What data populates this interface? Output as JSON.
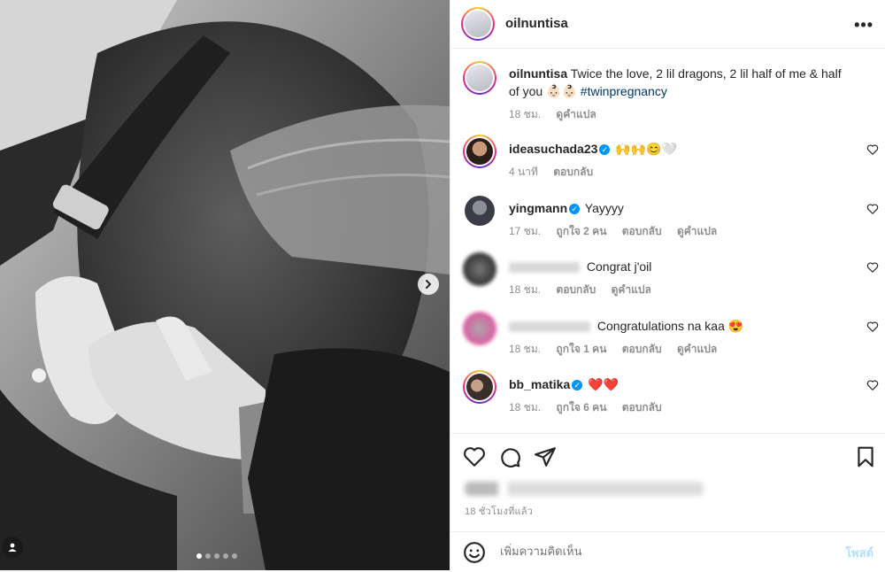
{
  "post": {
    "username": "oilnuntisa",
    "more_label": "•••",
    "caption_user": "oilnuntisa",
    "caption_text": "Twice the love, 2 lil dragons, 2 lil half of me & half of you 👶🏻👶🏻",
    "caption_hashtag": "#twinpregnancy",
    "caption_time": "18 ชม.",
    "caption_translate": "ดูคำแปล",
    "carousel_total": 5,
    "carousel_active": 1
  },
  "comments": [
    {
      "user": "ideasuchada23",
      "verified": true,
      "text": "🙌🙌😊🤍",
      "time": "4 นาที",
      "likes": "",
      "reply": "ตอบกลับ",
      "translate": ""
    },
    {
      "user": "yingmann",
      "verified": true,
      "text": "Yayyyy",
      "time": "17 ชม.",
      "likes": "ถูกใจ 2 คน",
      "reply": "ตอบกลับ",
      "translate": "ดูคำแปล"
    },
    {
      "user": "",
      "verified": false,
      "text": "Congrat j'oil",
      "time": "18 ชม.",
      "likes": "",
      "reply": "ตอบกลับ",
      "translate": "ดูคำแปล"
    },
    {
      "user": "",
      "verified": false,
      "text": "Congratulations na kaa 😍",
      "time": "18 ชม.",
      "likes": "ถูกใจ 1 คน",
      "reply": "ตอบกลับ",
      "translate": "ดูคำแปล"
    },
    {
      "user": "bb_matika",
      "verified": true,
      "text": "❤️❤️",
      "time": "18 ชม.",
      "likes": "ถูกใจ 6 คน",
      "reply": "ตอบกลับ",
      "translate": ""
    }
  ],
  "footer": {
    "time_ago": "18 ชั่วโมงที่แล้ว",
    "comment_placeholder": "เพิ่มความคิดเห็น",
    "post_label": "โพสต์"
  },
  "icons": {
    "like": "heart-icon",
    "comment": "comment-icon",
    "share": "share-icon",
    "save": "bookmark-icon",
    "emoji": "emoji-icon",
    "next": "chevron-right-icon",
    "tag": "user-tag-icon"
  },
  "colors": {
    "link": "#00376b",
    "verified": "#0095f6",
    "post_disabled": "#b2dffc",
    "muted": "#8e8e8e"
  }
}
